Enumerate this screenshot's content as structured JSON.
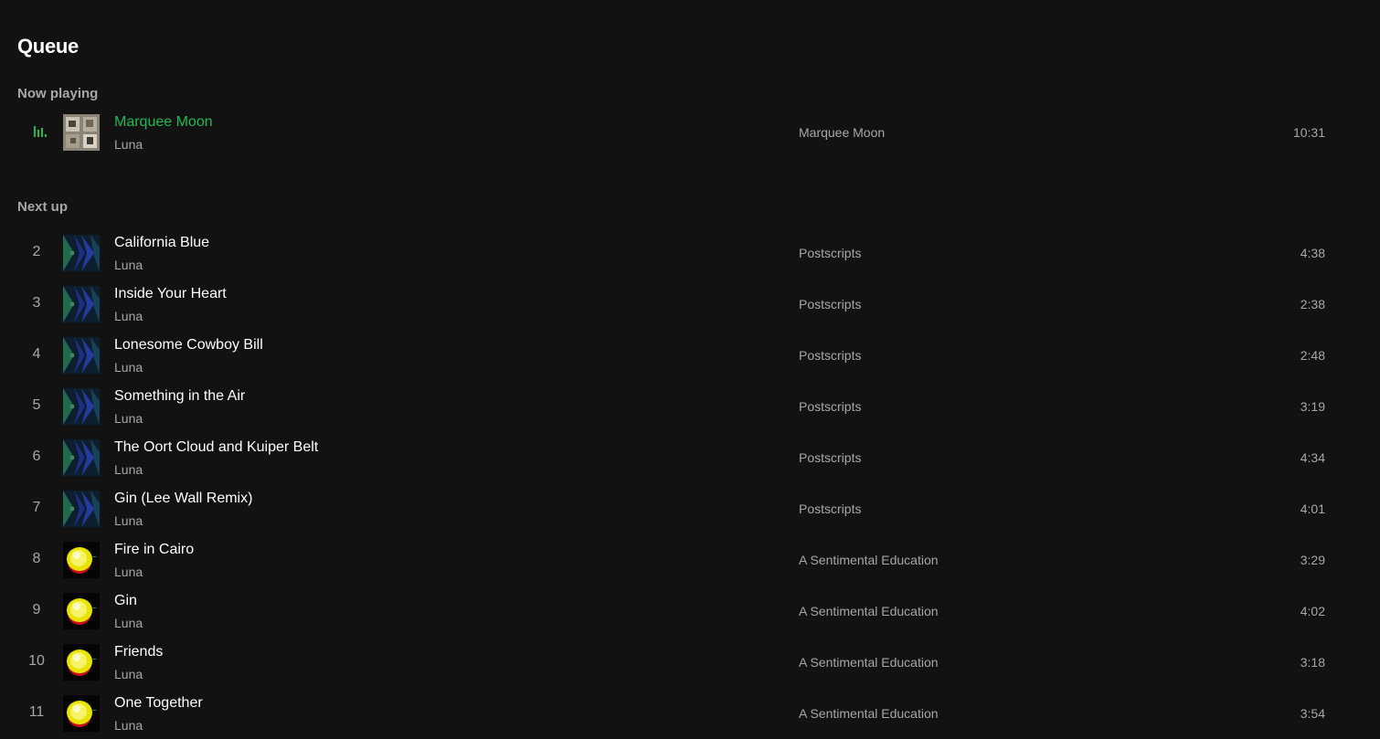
{
  "page": {
    "title": "Queue"
  },
  "now_playing": {
    "heading": "Now playing",
    "track": {
      "title": "Marquee Moon",
      "artist": "Luna",
      "album": "Marquee Moon",
      "duration": "10:31",
      "icon": "equalizer-icon"
    }
  },
  "next_up": {
    "heading": "Next up",
    "tracks": [
      {
        "index": "2",
        "title": "California Blue",
        "artist": "Luna",
        "album": "Postscripts",
        "duration": "4:38"
      },
      {
        "index": "3",
        "title": "Inside Your Heart",
        "artist": "Luna",
        "album": "Postscripts",
        "duration": "2:38"
      },
      {
        "index": "4",
        "title": "Lonesome Cowboy Bill",
        "artist": "Luna",
        "album": "Postscripts",
        "duration": "2:48"
      },
      {
        "index": "5",
        "title": "Something in the Air",
        "artist": "Luna",
        "album": "Postscripts",
        "duration": "3:19"
      },
      {
        "index": "6",
        "title": "The Oort Cloud and Kuiper Belt",
        "artist": "Luna",
        "album": "Postscripts",
        "duration": "4:34"
      },
      {
        "index": "7",
        "title": "Gin (Lee Wall Remix)",
        "artist": "Luna",
        "album": "Postscripts",
        "duration": "4:01"
      },
      {
        "index": "8",
        "title": "Fire in Cairo",
        "artist": "Luna",
        "album": "A Sentimental Education",
        "duration": "3:29"
      },
      {
        "index": "9",
        "title": "Gin",
        "artist": "Luna",
        "album": "A Sentimental Education",
        "duration": "4:02"
      },
      {
        "index": "10",
        "title": "Friends",
        "artist": "Luna",
        "album": "A Sentimental Education",
        "duration": "3:18"
      },
      {
        "index": "11",
        "title": "One Together",
        "artist": "Luna",
        "album": "A Sentimental Education",
        "duration": "3:54"
      }
    ]
  },
  "colors": {
    "background": "#121212",
    "accent": "#1db954",
    "text_primary": "#ffffff",
    "text_secondary": "#a7a7a7"
  }
}
